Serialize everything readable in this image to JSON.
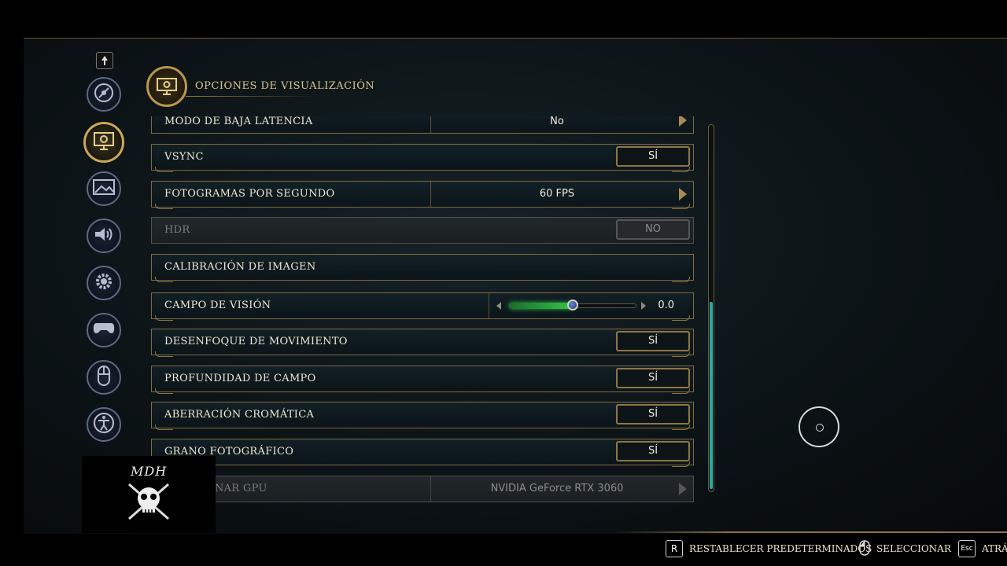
{
  "header": {
    "title": "OPCIONES DE VISUALIZACIÓN",
    "icon": "monitor-gear-icon"
  },
  "sidebar": {
    "top_icon": "up-arrow-icon",
    "items": [
      {
        "icon": "disc-icon",
        "active": false
      },
      {
        "icon": "monitor-gear-icon",
        "active": true
      },
      {
        "icon": "image-icon",
        "active": false
      },
      {
        "icon": "speaker-icon",
        "active": false
      },
      {
        "icon": "gear-icon",
        "active": false
      },
      {
        "icon": "gamepad-icon",
        "active": false
      },
      {
        "icon": "mouse-icon",
        "active": false
      },
      {
        "icon": "accessibility-icon",
        "active": false
      }
    ]
  },
  "settings": {
    "low_latency": {
      "label": "MODO DE BAJA LATENCIA",
      "value": "No"
    },
    "vsync": {
      "label": "VSYNC",
      "value": "SÍ"
    },
    "fps": {
      "label": "FOTOGRAMAS POR SEGUNDO",
      "value": "60 FPS"
    },
    "hdr": {
      "label": "HDR",
      "value": "NO"
    },
    "calibration": {
      "label": "CALIBRACIÓN DE IMAGEN"
    },
    "fov": {
      "label": "CAMPO DE VISIÓN",
      "value": "0.0",
      "slider_fraction": 0.5
    },
    "motion_blur": {
      "label": "DESENFOQUE DE MOVIMIENTO",
      "value": "SÍ"
    },
    "depth_of_field": {
      "label": "PROFUNDIDAD DE CAMPO",
      "value": "SÍ"
    },
    "chromatic": {
      "label": "ABERRACIÓN CROMÁTICA",
      "value": "SÍ"
    },
    "film_grain": {
      "label": "GRANO FOTOGRÁFICO",
      "value": "SÍ"
    },
    "gpu": {
      "label": "NAR GPU",
      "value": "NVIDIA GeForce RTX 3060"
    }
  },
  "watermark": {
    "text": "MDH"
  },
  "footer": {
    "reset_key": "R",
    "reset_label": "RESTABLECER PREDETERMINADOS",
    "select_label": "SELECCIONAR",
    "back_key": "Esc",
    "back_label": "ATRÁS"
  },
  "colors": {
    "accent_gold": "#c9a85a",
    "slider_green": "#35c24a",
    "scroll_teal": "#2aa8a2"
  }
}
